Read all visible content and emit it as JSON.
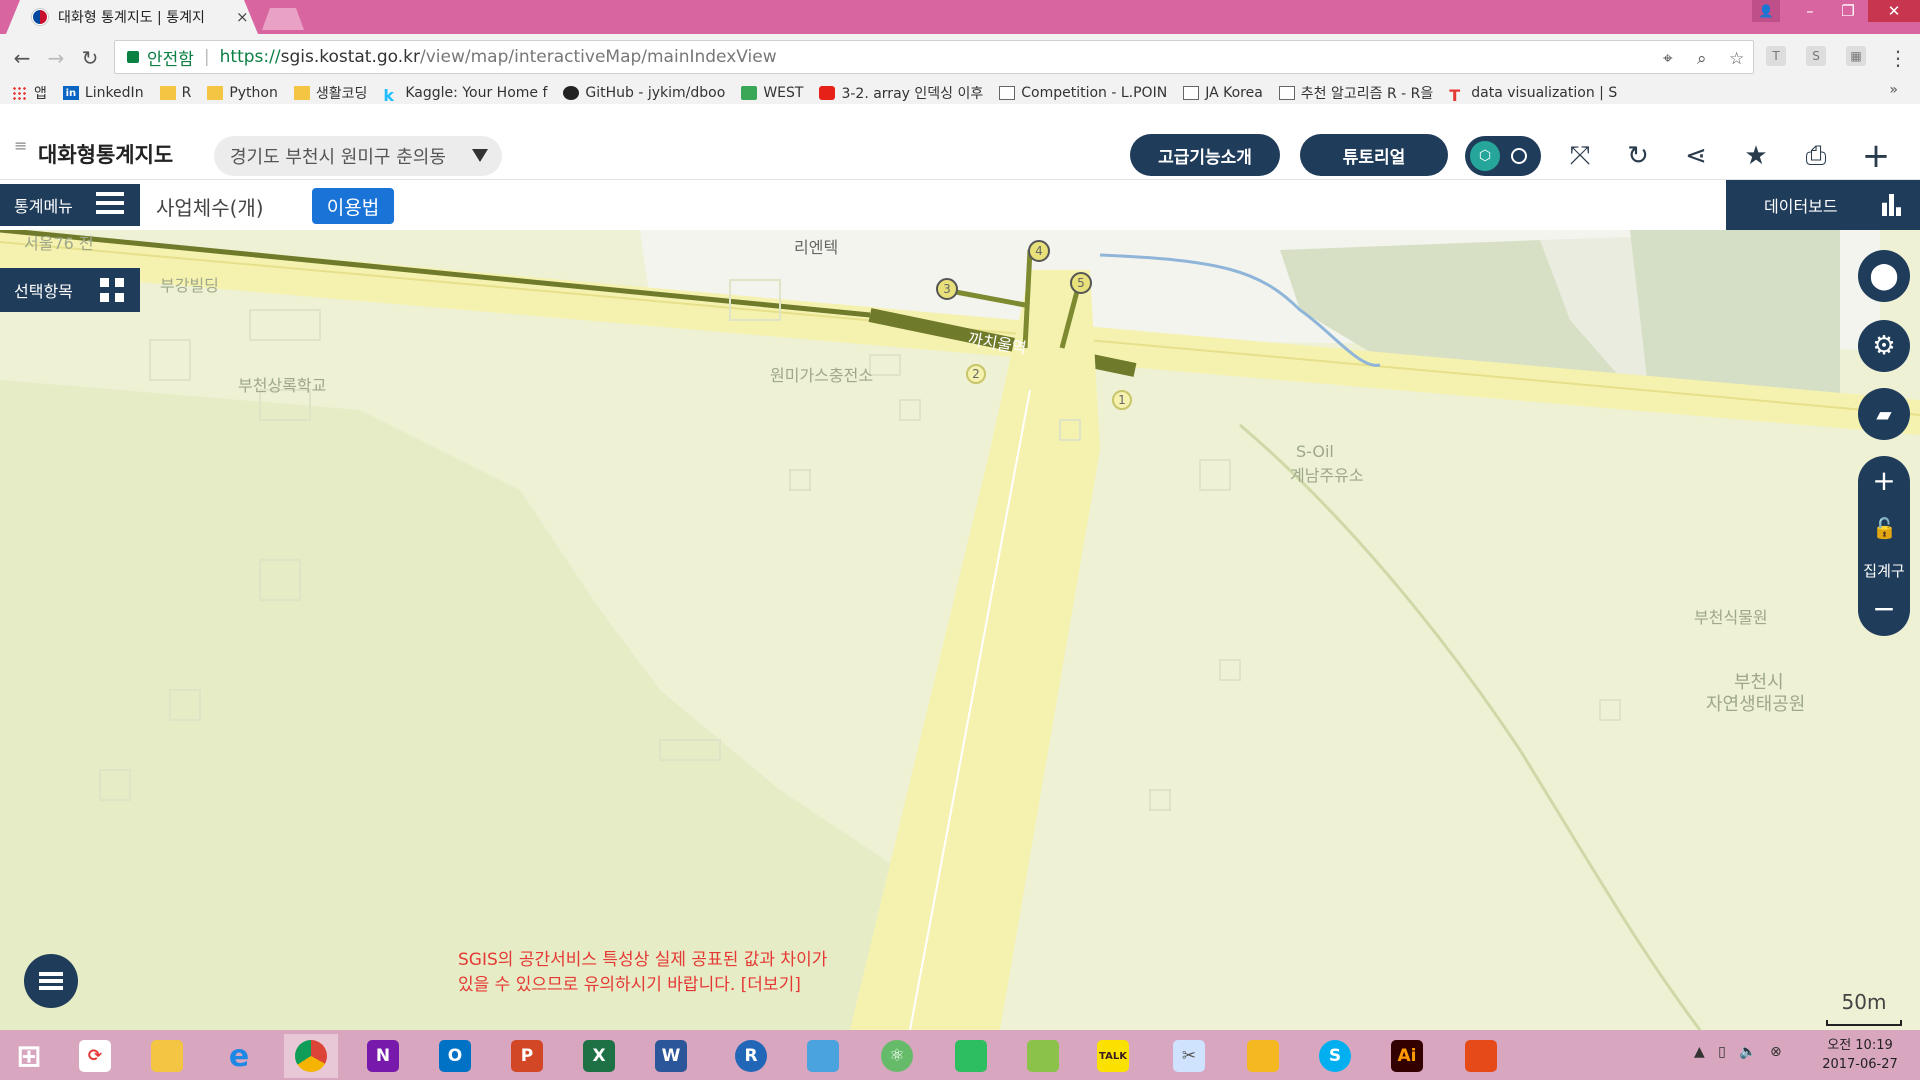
{
  "browser": {
    "tab_title": "대화형 통계지도 | 통계지",
    "tab_close": "×",
    "url_secure_label": "안전함",
    "url_scheme": "https://",
    "url_host": "sgis.kostat.go.kr",
    "url_path": "/view/map/interactiveMap/mainIndexView",
    "window_controls": {
      "minimize": "–",
      "maximize": "❐",
      "close": "✕"
    }
  },
  "bookmarks": [
    {
      "label": "앱",
      "icon": "apps-icon"
    },
    {
      "label": "LinkedIn",
      "icon": "linkedin-icon"
    },
    {
      "label": "R",
      "icon": "folder-icon"
    },
    {
      "label": "Python",
      "icon": "folder-icon"
    },
    {
      "label": "생활코딩",
      "icon": "folder-icon"
    },
    {
      "label": "Kaggle: Your Home f",
      "icon": "kaggle-icon"
    },
    {
      "label": "GitHub - jykim/dboo",
      "icon": "github-icon"
    },
    {
      "label": "WEST",
      "icon": "west-icon"
    },
    {
      "label": "3-2. array 인덱싱 이후",
      "icon": "youtube-icon"
    },
    {
      "label": "Competition - L.POIN",
      "icon": "document-icon"
    },
    {
      "label": "JA Korea",
      "icon": "document-icon"
    },
    {
      "label": "추천 알고리즘 R - R을",
      "icon": "document-icon"
    },
    {
      "label": "data visualization | S",
      "icon": "t-icon"
    }
  ],
  "bookmarks_more": "»",
  "app": {
    "title": "대화형통계지도",
    "region": "경기도 부천시 원미구 춘의동",
    "advanced_btn": "고급기능소개",
    "tutorial_btn": "튜토리얼",
    "stat_menu": "통계메뉴",
    "stat_label": "사업체수(개)",
    "usage_btn": "이용법",
    "databoard": "데이터보드",
    "select_items": "선택항목"
  },
  "map": {
    "labels": {
      "seoul76": "서울76 전",
      "bugang": "부강빌딩",
      "school": "부천상록학교",
      "rientech": "리엔텍",
      "gas": "원미가스충전소",
      "station": "까치울역",
      "soil1": "S-Oil",
      "soil2": "계남주유소",
      "arboretum": "부천식물원",
      "park1": "부천시",
      "park2": "자연생태공원"
    },
    "exits": [
      "1",
      "2",
      "3",
      "4",
      "5"
    ],
    "zoom_in": "+",
    "zoom_out": "−",
    "zoom_label": "집계구",
    "notice_line1": "SGIS의 공간서비스 특성상 실제 공표된 값과 차이가",
    "notice_line2": "있을 수 있으므로 유의하시기 바랍니다. [더보기]",
    "scale": "50m"
  },
  "taskbar": {
    "apps": [
      "windows-start-icon",
      "sync-icon",
      "file-explorer-icon",
      "internet-explorer-icon",
      "chrome-icon",
      "onenote-icon",
      "outlook-icon",
      "powerpoint-icon",
      "excel-icon",
      "word-icon",
      "r-icon",
      "notepad-icon",
      "atom-icon",
      "evernote-icon",
      "photo-icon",
      "kakaotalk-icon",
      "snipping-icon",
      "puzzle-icon",
      "skype-icon",
      "illustrator-icon",
      "app-icon"
    ],
    "ppt_letter": "P",
    "excel_letter": "X",
    "word_letter": "W",
    "onenote_letter": "N",
    "outlook_letter": "O",
    "r_letter": "R",
    "ai_letter": "Ai",
    "talk": "TALK",
    "time_line1": "오전 10:19",
    "time_line2": "2017-06-27"
  }
}
